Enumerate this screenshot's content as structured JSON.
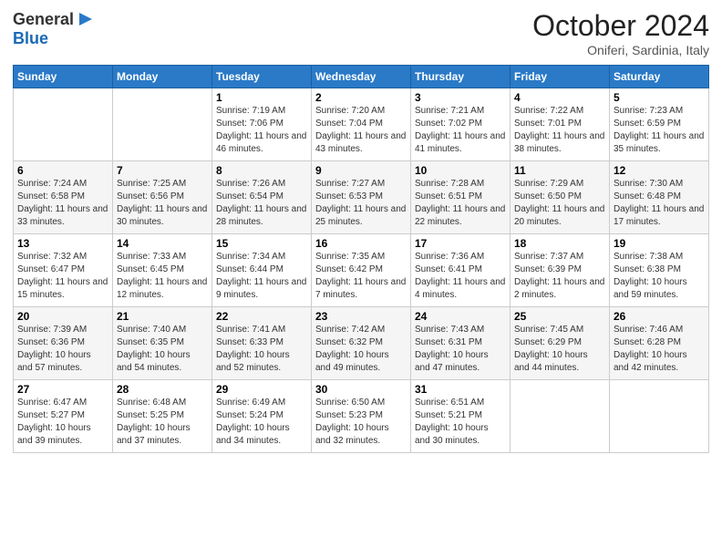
{
  "header": {
    "logo_general": "General",
    "logo_blue": "Blue",
    "month_title": "October 2024",
    "subtitle": "Oniferi, Sardinia, Italy"
  },
  "days_of_week": [
    "Sunday",
    "Monday",
    "Tuesday",
    "Wednesday",
    "Thursday",
    "Friday",
    "Saturday"
  ],
  "weeks": [
    [
      {
        "day": "",
        "sunrise": "",
        "sunset": "",
        "daylight": ""
      },
      {
        "day": "",
        "sunrise": "",
        "sunset": "",
        "daylight": ""
      },
      {
        "day": "1",
        "sunrise": "Sunrise: 7:19 AM",
        "sunset": "Sunset: 7:06 PM",
        "daylight": "Daylight: 11 hours and 46 minutes."
      },
      {
        "day": "2",
        "sunrise": "Sunrise: 7:20 AM",
        "sunset": "Sunset: 7:04 PM",
        "daylight": "Daylight: 11 hours and 43 minutes."
      },
      {
        "day": "3",
        "sunrise": "Sunrise: 7:21 AM",
        "sunset": "Sunset: 7:02 PM",
        "daylight": "Daylight: 11 hours and 41 minutes."
      },
      {
        "day": "4",
        "sunrise": "Sunrise: 7:22 AM",
        "sunset": "Sunset: 7:01 PM",
        "daylight": "Daylight: 11 hours and 38 minutes."
      },
      {
        "day": "5",
        "sunrise": "Sunrise: 7:23 AM",
        "sunset": "Sunset: 6:59 PM",
        "daylight": "Daylight: 11 hours and 35 minutes."
      }
    ],
    [
      {
        "day": "6",
        "sunrise": "Sunrise: 7:24 AM",
        "sunset": "Sunset: 6:58 PM",
        "daylight": "Daylight: 11 hours and 33 minutes."
      },
      {
        "day": "7",
        "sunrise": "Sunrise: 7:25 AM",
        "sunset": "Sunset: 6:56 PM",
        "daylight": "Daylight: 11 hours and 30 minutes."
      },
      {
        "day": "8",
        "sunrise": "Sunrise: 7:26 AM",
        "sunset": "Sunset: 6:54 PM",
        "daylight": "Daylight: 11 hours and 28 minutes."
      },
      {
        "day": "9",
        "sunrise": "Sunrise: 7:27 AM",
        "sunset": "Sunset: 6:53 PM",
        "daylight": "Daylight: 11 hours and 25 minutes."
      },
      {
        "day": "10",
        "sunrise": "Sunrise: 7:28 AM",
        "sunset": "Sunset: 6:51 PM",
        "daylight": "Daylight: 11 hours and 22 minutes."
      },
      {
        "day": "11",
        "sunrise": "Sunrise: 7:29 AM",
        "sunset": "Sunset: 6:50 PM",
        "daylight": "Daylight: 11 hours and 20 minutes."
      },
      {
        "day": "12",
        "sunrise": "Sunrise: 7:30 AM",
        "sunset": "Sunset: 6:48 PM",
        "daylight": "Daylight: 11 hours and 17 minutes."
      }
    ],
    [
      {
        "day": "13",
        "sunrise": "Sunrise: 7:32 AM",
        "sunset": "Sunset: 6:47 PM",
        "daylight": "Daylight: 11 hours and 15 minutes."
      },
      {
        "day": "14",
        "sunrise": "Sunrise: 7:33 AM",
        "sunset": "Sunset: 6:45 PM",
        "daylight": "Daylight: 11 hours and 12 minutes."
      },
      {
        "day": "15",
        "sunrise": "Sunrise: 7:34 AM",
        "sunset": "Sunset: 6:44 PM",
        "daylight": "Daylight: 11 hours and 9 minutes."
      },
      {
        "day": "16",
        "sunrise": "Sunrise: 7:35 AM",
        "sunset": "Sunset: 6:42 PM",
        "daylight": "Daylight: 11 hours and 7 minutes."
      },
      {
        "day": "17",
        "sunrise": "Sunrise: 7:36 AM",
        "sunset": "Sunset: 6:41 PM",
        "daylight": "Daylight: 11 hours and 4 minutes."
      },
      {
        "day": "18",
        "sunrise": "Sunrise: 7:37 AM",
        "sunset": "Sunset: 6:39 PM",
        "daylight": "Daylight: 11 hours and 2 minutes."
      },
      {
        "day": "19",
        "sunrise": "Sunrise: 7:38 AM",
        "sunset": "Sunset: 6:38 PM",
        "daylight": "Daylight: 10 hours and 59 minutes."
      }
    ],
    [
      {
        "day": "20",
        "sunrise": "Sunrise: 7:39 AM",
        "sunset": "Sunset: 6:36 PM",
        "daylight": "Daylight: 10 hours and 57 minutes."
      },
      {
        "day": "21",
        "sunrise": "Sunrise: 7:40 AM",
        "sunset": "Sunset: 6:35 PM",
        "daylight": "Daylight: 10 hours and 54 minutes."
      },
      {
        "day": "22",
        "sunrise": "Sunrise: 7:41 AM",
        "sunset": "Sunset: 6:33 PM",
        "daylight": "Daylight: 10 hours and 52 minutes."
      },
      {
        "day": "23",
        "sunrise": "Sunrise: 7:42 AM",
        "sunset": "Sunset: 6:32 PM",
        "daylight": "Daylight: 10 hours and 49 minutes."
      },
      {
        "day": "24",
        "sunrise": "Sunrise: 7:43 AM",
        "sunset": "Sunset: 6:31 PM",
        "daylight": "Daylight: 10 hours and 47 minutes."
      },
      {
        "day": "25",
        "sunrise": "Sunrise: 7:45 AM",
        "sunset": "Sunset: 6:29 PM",
        "daylight": "Daylight: 10 hours and 44 minutes."
      },
      {
        "day": "26",
        "sunrise": "Sunrise: 7:46 AM",
        "sunset": "Sunset: 6:28 PM",
        "daylight": "Daylight: 10 hours and 42 minutes."
      }
    ],
    [
      {
        "day": "27",
        "sunrise": "Sunrise: 6:47 AM",
        "sunset": "Sunset: 5:27 PM",
        "daylight": "Daylight: 10 hours and 39 minutes."
      },
      {
        "day": "28",
        "sunrise": "Sunrise: 6:48 AM",
        "sunset": "Sunset: 5:25 PM",
        "daylight": "Daylight: 10 hours and 37 minutes."
      },
      {
        "day": "29",
        "sunrise": "Sunrise: 6:49 AM",
        "sunset": "Sunset: 5:24 PM",
        "daylight": "Daylight: 10 hours and 34 minutes."
      },
      {
        "day": "30",
        "sunrise": "Sunrise: 6:50 AM",
        "sunset": "Sunset: 5:23 PM",
        "daylight": "Daylight: 10 hours and 32 minutes."
      },
      {
        "day": "31",
        "sunrise": "Sunrise: 6:51 AM",
        "sunset": "Sunset: 5:21 PM",
        "daylight": "Daylight: 10 hours and 30 minutes."
      },
      {
        "day": "",
        "sunrise": "",
        "sunset": "",
        "daylight": ""
      },
      {
        "day": "",
        "sunrise": "",
        "sunset": "",
        "daylight": ""
      }
    ]
  ]
}
